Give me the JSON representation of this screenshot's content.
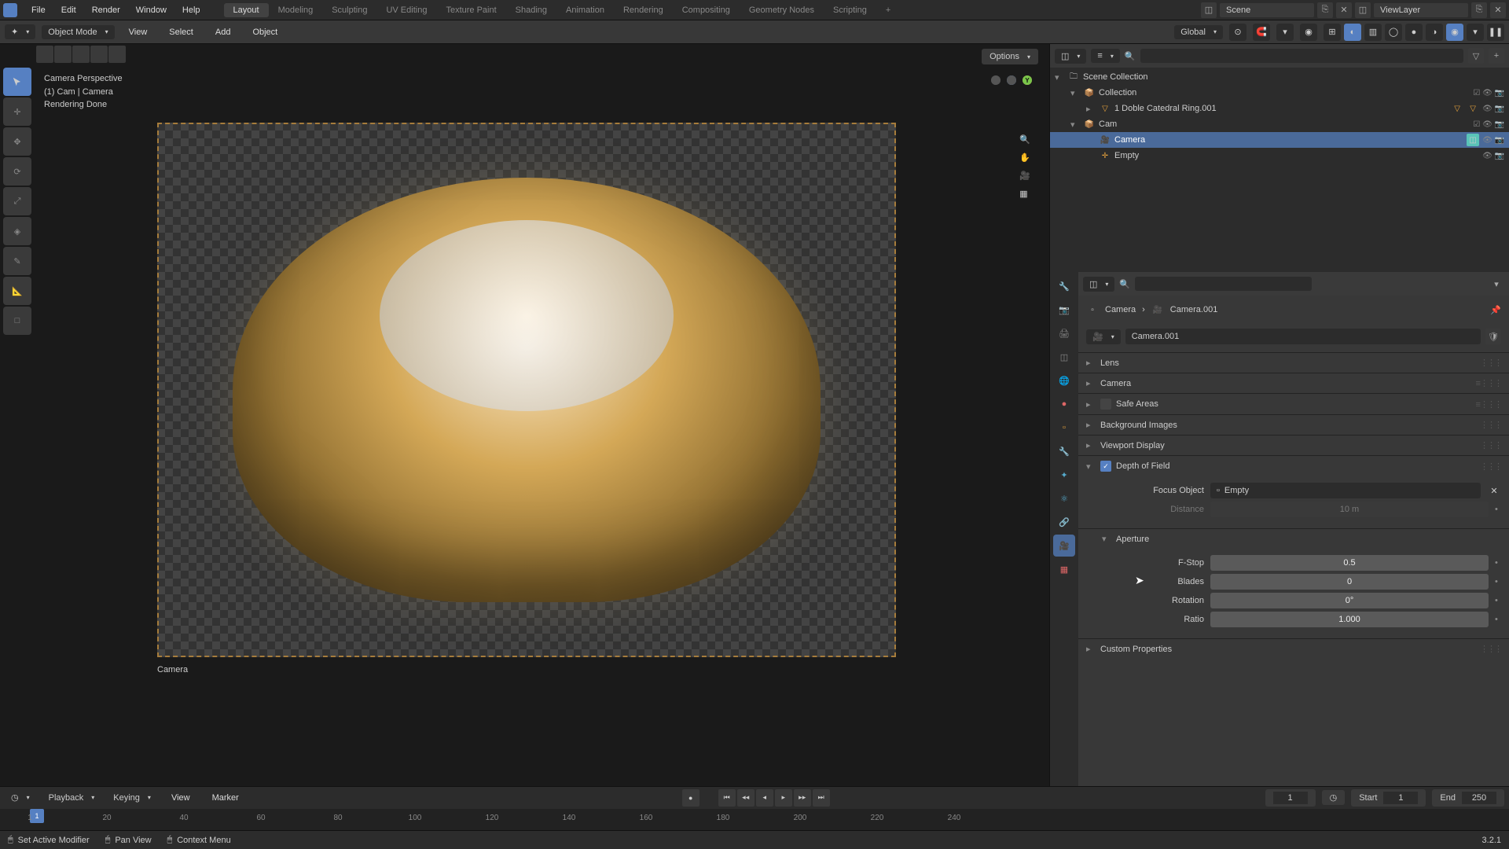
{
  "menus": [
    "File",
    "Edit",
    "Render",
    "Window",
    "Help"
  ],
  "workspaces": [
    "Layout",
    "Modeling",
    "Sculpting",
    "UV Editing",
    "Texture Paint",
    "Shading",
    "Animation",
    "Rendering",
    "Compositing",
    "Geometry Nodes",
    "Scripting"
  ],
  "active_workspace": "Layout",
  "scene_name": "Scene",
  "viewlayer_name": "ViewLayer",
  "mode": "Object Mode",
  "header_menus": [
    "View",
    "Select",
    "Add",
    "Object"
  ],
  "transform_orientation": "Global",
  "options_label": "Options",
  "overlay": {
    "line1": "Camera Perspective",
    "line2": "(1) Cam | Camera",
    "line3": "Rendering Done"
  },
  "camera_label": "Camera",
  "outliner": {
    "root": "Scene Collection",
    "items": [
      {
        "label": "Collection",
        "depth": 1,
        "arrow": "▾",
        "icon": "📦"
      },
      {
        "label": "1 Doble Catedral Ring.001",
        "depth": 2,
        "arrow": "▸",
        "icon": "▽",
        "extra": true
      },
      {
        "label": "Cam",
        "depth": 1,
        "arrow": "▾",
        "icon": "📦"
      },
      {
        "label": "Camera",
        "depth": 2,
        "arrow": "",
        "icon": "🎥",
        "selected": true
      },
      {
        "label": "Empty",
        "depth": 2,
        "arrow": "",
        "icon": "✛"
      }
    ]
  },
  "breadcrumb": {
    "obj": "Camera",
    "data": "Camera.001"
  },
  "datablock_name": "Camera.001",
  "panels": {
    "lens": "Lens",
    "camera": "Camera",
    "safe": "Safe Areas",
    "bg": "Background Images",
    "vpd": "Viewport Display",
    "dof": "Depth of Field",
    "aperture": "Aperture",
    "custom": "Custom Properties"
  },
  "dof": {
    "focus_label": "Focus Object",
    "focus_value": "Empty",
    "distance_label": "Distance",
    "distance_value": "10 m"
  },
  "aperture": {
    "fstop_label": "F-Stop",
    "fstop_value": "0.5",
    "blades_label": "Blades",
    "blades_value": "0",
    "rotation_label": "Rotation",
    "rotation_value": "0°",
    "ratio_label": "Ratio",
    "ratio_value": "1.000"
  },
  "timeline": {
    "playback": "Playback",
    "keying": "Keying",
    "view": "View",
    "marker": "Marker",
    "current": "1",
    "start_label": "Start",
    "start": "1",
    "end_label": "End",
    "end": "250",
    "marks": [
      1,
      20,
      40,
      60,
      80,
      100,
      120,
      140,
      160,
      180,
      200,
      220,
      240
    ]
  },
  "status": {
    "modifier": "Set Active Modifier",
    "pan": "Pan View",
    "context": "Context Menu"
  },
  "version": "3.2.1"
}
